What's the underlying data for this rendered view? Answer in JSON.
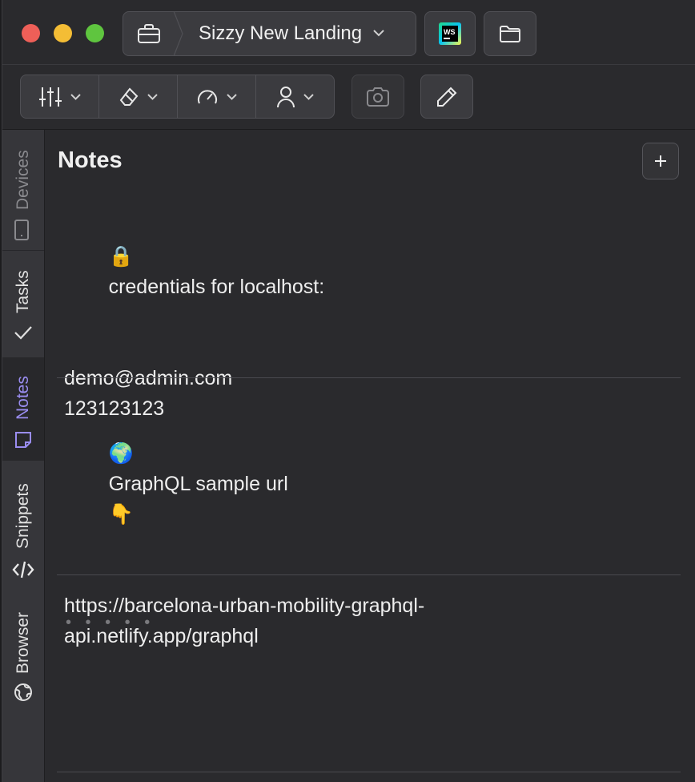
{
  "window": {
    "traffic_lights": [
      "close",
      "minimize",
      "zoom"
    ]
  },
  "project": {
    "name": "Sizzy New Landing",
    "icon": "briefcase-icon"
  },
  "titlebar_buttons": [
    {
      "name": "webstorm",
      "label": "WS"
    },
    {
      "name": "open-folder",
      "icon": "folder-icon"
    }
  ],
  "toolbar": {
    "groups": [
      {
        "icon": "sliders-icon"
      },
      {
        "icon": "eraser-icon"
      },
      {
        "icon": "gauge-icon"
      },
      {
        "icon": "user-icon"
      }
    ],
    "camera_icon": "camera-icon",
    "pencil_icon": "pencil-icon"
  },
  "sidebar": {
    "tabs": [
      {
        "label": "Devices",
        "icon": "phone-icon",
        "state": "dim"
      },
      {
        "label": "Tasks",
        "icon": "check-icon",
        "state": "normal"
      },
      {
        "label": "Notes",
        "icon": "sticky-note-icon",
        "state": "active"
      },
      {
        "label": "Snippets",
        "icon": "code-icon",
        "state": "normal"
      },
      {
        "label": "Browser",
        "icon": "globe-icon",
        "state": "normal"
      }
    ]
  },
  "notes": {
    "title": "Notes",
    "add_label": "+",
    "items": [
      {
        "emoji": "🔒",
        "heading": "credentials for localhost:",
        "lines": [
          "demo@admin.com",
          "123123123"
        ]
      },
      {
        "emoji": "🌍",
        "heading": "GraphQL sample url",
        "heading_emoji": "👇",
        "lines": [
          "https://barcelona-urban-mobility-graphql-",
          "api.netlify.app/graphql"
        ]
      }
    ],
    "placeholder": "• • • • •"
  },
  "colors": {
    "accent": "#9a8df0",
    "background": "#2a2a2d",
    "rail": "#36363a"
  }
}
